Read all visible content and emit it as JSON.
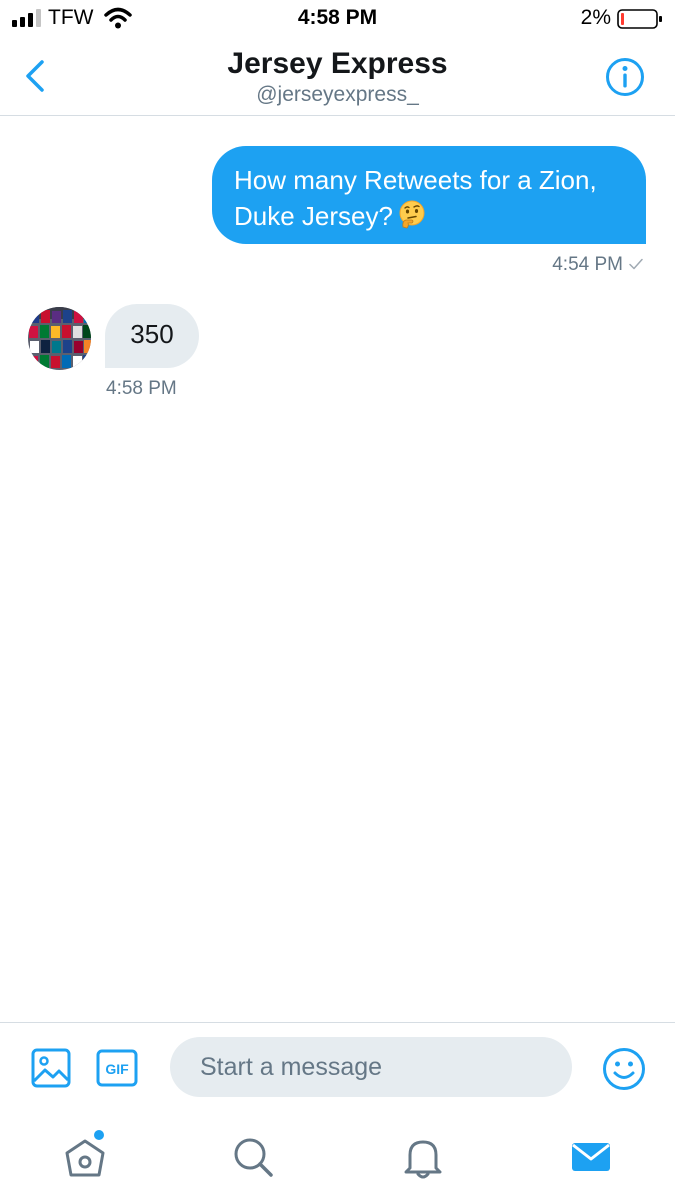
{
  "status_bar": {
    "carrier": "TFW",
    "time": "4:58 PM",
    "battery": "2%"
  },
  "header": {
    "title": "Jersey Express",
    "handle": "@jerseyexpress_"
  },
  "conversation": {
    "sent": {
      "line1": "How many Retweets for a Zion,",
      "line2": "Duke Jersey?",
      "emoji": "thinking-face-emoji",
      "time": "4:54 PM",
      "read_indicator": "check-icon"
    },
    "received": {
      "text": "350",
      "time": "4:58 PM"
    }
  },
  "composer": {
    "placeholder": "Start a message",
    "gif_label": "GIF"
  },
  "colors": {
    "accent": "#1da1f2",
    "received_bubble": "#e6ecf0",
    "meta_text": "#657786"
  }
}
